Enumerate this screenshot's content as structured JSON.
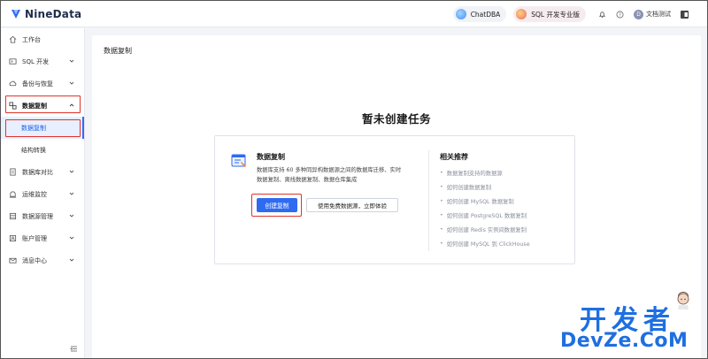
{
  "header": {
    "logo_text": "NineData",
    "chatdba_label": "ChatDBA",
    "sql_edition_label": "SQL 开发专业版",
    "avatar_letter": "D",
    "user_name": "文档测试"
  },
  "sidebar": {
    "items": [
      {
        "label": "工作台"
      },
      {
        "label": "SQL 开发"
      },
      {
        "label": "备份与恢复"
      },
      {
        "label": "数据复制"
      },
      {
        "label": "数据复制"
      },
      {
        "label": "结构转换"
      },
      {
        "label": "数据库对比"
      },
      {
        "label": "运维监控"
      },
      {
        "label": "数据源管理"
      },
      {
        "label": "账户管理"
      },
      {
        "label": "消息中心"
      }
    ]
  },
  "main": {
    "page_title": "数据复制",
    "empty_title": "暂未创建任务",
    "card": {
      "title": "数据复制",
      "description": "数据库支持 60 多种同异构数据源之间的数据库迁移、实时数据复制、离线数据复制、数据仓库集成",
      "primary_button": "创建复制",
      "secondary_button": "使用免费数据源，立即体验",
      "recommend_title": "相关推荐",
      "recommend_items": [
        "数据复制支持的数据源",
        "如何创建数据复制",
        "如何创建 MySQL 数据复制",
        "如何创建 PostgreSQL 数据复制",
        "如何创建 Redis 实例间数据复制",
        "如何创建 MySQL 到 ClickHouse"
      ]
    }
  },
  "watermark": {
    "line1": "开发者",
    "line2": "DevZe.CoM"
  },
  "colors": {
    "accent": "#2f6bf1",
    "highlight": "#e0322b",
    "watermark": "#1e6fe0"
  }
}
